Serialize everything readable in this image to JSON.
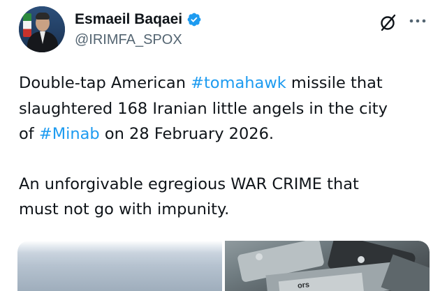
{
  "author": {
    "display_name": "Esmaeil Baqaei",
    "handle": "@IRIMFA_SPOX",
    "verified": true,
    "avatar_icon": "profile-photo"
  },
  "header_actions": {
    "grok_icon": "grok-icon",
    "more_icon": "more-horizontal-icon"
  },
  "tweet": {
    "p1_line1_pre": "Double-tap American ",
    "p1_hashtag1": "#tomahawk",
    "p1_line1_post": " missile that",
    "p1_line2": "slaughtered 168 Iranian little angels in the city",
    "p1_line3_pre": "of ",
    "p1_hashtag2": "#Minab",
    "p1_line3_post": " on 28 February 2026.",
    "p2_line1": "An unforgivable egregious WAR  CRIME that",
    "p2_line2": "must not go with impunity."
  },
  "media": {
    "right_image_text": "ors"
  },
  "colors": {
    "text": "#0f1419",
    "secondary": "#536471",
    "link": "#1d9bf0",
    "verified_badge": "#1d9bf0"
  }
}
